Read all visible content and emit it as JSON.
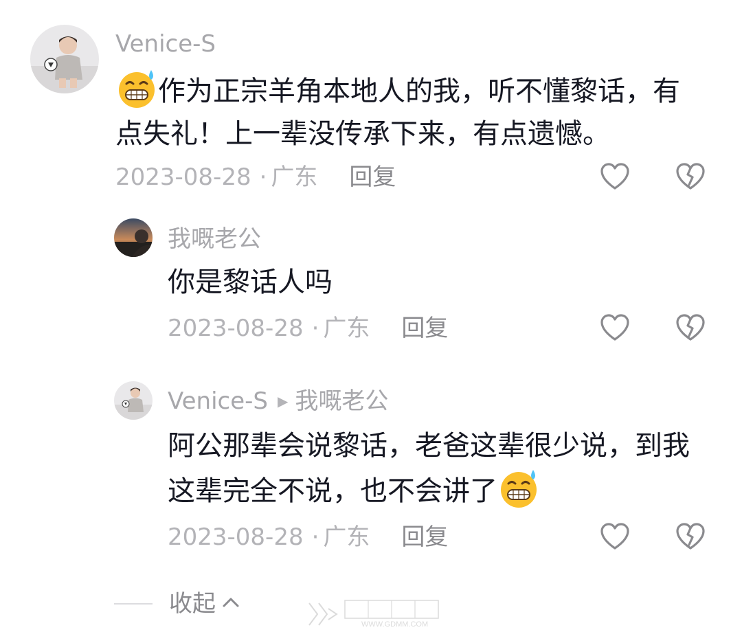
{
  "comments": [
    {
      "username": "Venice-S",
      "text_line1": "作为正宗羊角本地人的我，听不懂黎话，有",
      "text_line2": "点失礼！上一辈没传承下来，有点遗憾。",
      "leading_emoji": "sweat-smile-emoji",
      "date": "2023-08-28",
      "separator": "·",
      "location": "广东",
      "reply_label": "回复"
    }
  ],
  "replies": [
    {
      "username": "我嘅老公",
      "text": "你是黎话人吗",
      "date": "2023-08-28",
      "separator": "·",
      "location": "广东",
      "reply_label": "回复"
    },
    {
      "username": "Venice-S",
      "reply_indicator": "▶",
      "reply_to": "我嘅老公",
      "text_line1": "阿公那辈会说黎话，老爸这辈很少说，到我",
      "text_line2": "这辈完全不说，也不会讲了",
      "trailing_emoji": "sweat-smile-emoji",
      "date": "2023-08-28",
      "separator": "·",
      "location": "广东",
      "reply_label": "回复"
    }
  ],
  "collapse_label": "收起",
  "icons": {
    "like": "heart-outline-icon",
    "dislike": "broken-heart-icon",
    "collapse": "chevron-up-icon"
  },
  "watermark_text": "WWW.GDMM.COM",
  "colors": {
    "text_primary": "#161823",
    "text_secondary": "#a7a7ab",
    "icon_gray": "#8a8a8e",
    "background": "#ffffff"
  }
}
